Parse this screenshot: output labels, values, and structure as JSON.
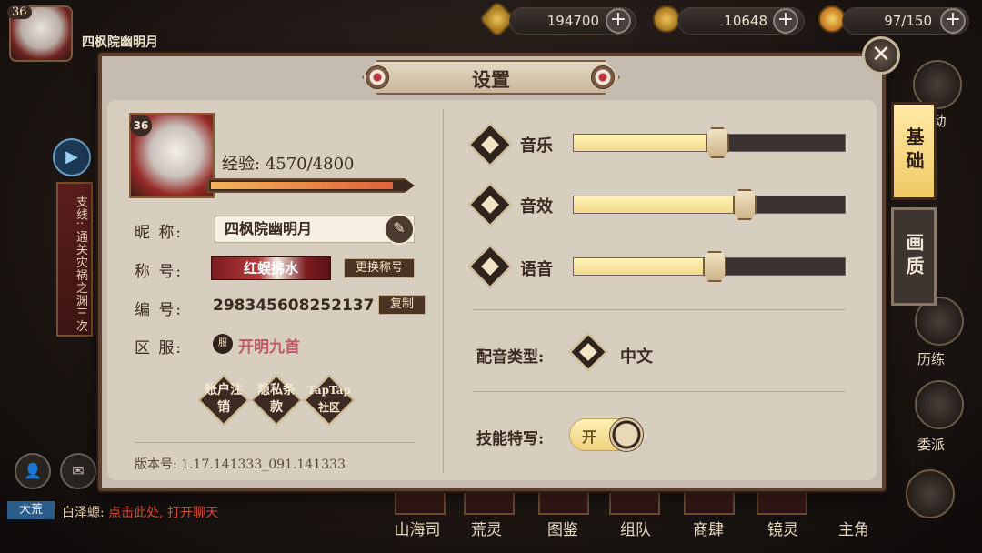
{
  "player": {
    "level": "36",
    "name": "四枫院幽明月",
    "exp_label": "经验: 4570/4800",
    "exp_fraction": 0.952
  },
  "hud": {
    "currency_1": "194700",
    "currency_2": "10648",
    "stamina": "97/150",
    "plus_glyph": "+"
  },
  "left_panel": {
    "side_quest": "支线: 通关灾祸之渊三次",
    "play_glyph": "▶"
  },
  "chat": {
    "channel": "大荒",
    "speaker": "白泽螈:",
    "message": "点击此处, 打开聊天"
  },
  "right_nav": [
    "动",
    "历练",
    "委派"
  ],
  "bottom_nav": [
    "山海司",
    "荒灵",
    "图鉴",
    "组队",
    "商肆",
    "镜灵",
    "主角"
  ],
  "settings": {
    "title": "设置",
    "close_glyph": "✕",
    "tabs": {
      "basic": "基础",
      "graphics": "画质"
    },
    "profile": {
      "nickname_label": "昵  称:",
      "nickname_value": "四枫院幽明月",
      "edit_glyph": "✎",
      "title_label": "称  号:",
      "title_value": "红蜈拂水",
      "change_title_button": "更换称号",
      "id_label": "编  号:",
      "id_value": "298345608252137",
      "copy_button": "复制",
      "server_label": "区  服:",
      "server_icon_text": "服",
      "server_value": "开明九首",
      "buttons": [
        {
          "label": "账户注销"
        },
        {
          "label": "隐私条款"
        },
        {
          "label": "TapTap社区"
        }
      ],
      "version": "版本号: 1.17.141333_091.141333"
    },
    "audio": [
      {
        "label": "音乐",
        "level": 0.53
      },
      {
        "label": "音效",
        "level": 0.63
      },
      {
        "label": "语音",
        "level": 0.52
      }
    ],
    "voice_type_label": "配音类型:",
    "voice_type_value": "中文",
    "skill_closeup_label": "技能特写:",
    "skill_closeup_value": "开"
  },
  "colors": {
    "panel_bg": "#d7cebf",
    "accent_gold": "#f0d98a",
    "server_pink": "#c0576a",
    "exp_orange": "#e0613a"
  }
}
